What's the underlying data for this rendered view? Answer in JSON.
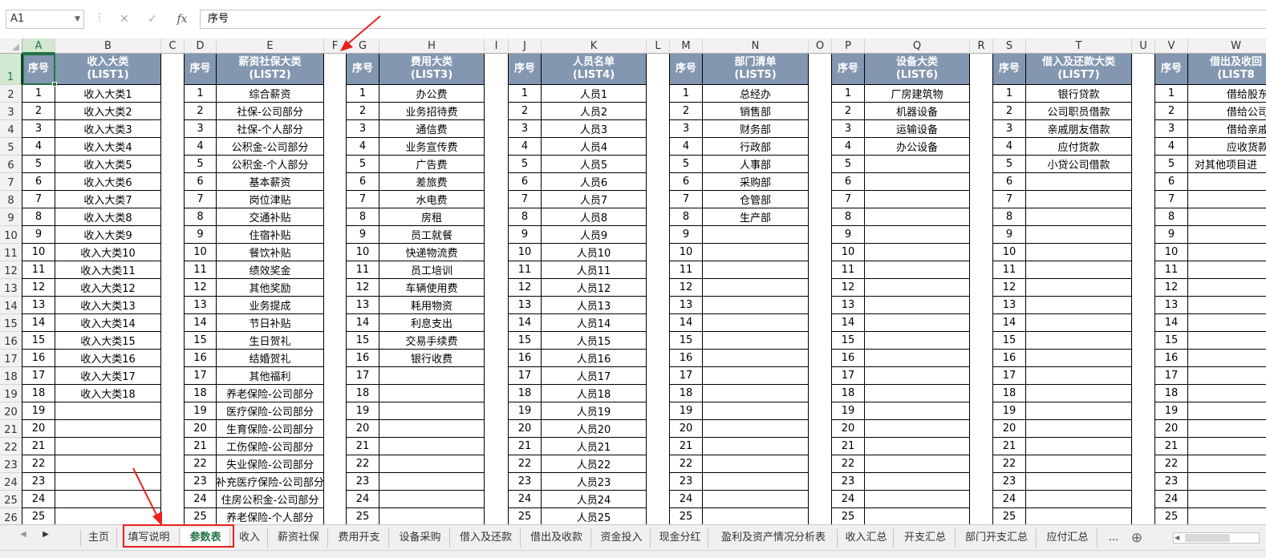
{
  "namebox": {
    "value": "A1"
  },
  "formula": {
    "value": "序号",
    "cancel_icon": "✕",
    "enter_icon": "✓",
    "fx_label": "fx"
  },
  "columns": [
    "A",
    "B",
    "C",
    "D",
    "E",
    "F",
    "G",
    "H",
    "I",
    "J",
    "K",
    "L",
    "M",
    "N",
    "O",
    "P",
    "Q",
    "R",
    "S",
    "T",
    "U",
    "V",
    "W"
  ],
  "rows": [
    "1",
    "2",
    "3",
    "4",
    "5",
    "6",
    "7",
    "8",
    "9",
    "10",
    "11",
    "12",
    "13",
    "14",
    "15",
    "16",
    "17",
    "18",
    "19",
    "20",
    "21",
    "22",
    "23",
    "24",
    "25",
    "26"
  ],
  "tables": [
    {
      "title": "收入大类",
      "sub": "(LIST1)",
      "items": [
        "收入大类1",
        "收入大类2",
        "收入大类3",
        "收入大类4",
        "收入大类5",
        "收入大类6",
        "收入大类7",
        "收入大类8",
        "收入大类9",
        "收入大类10",
        "收入大类11",
        "收入大类12",
        "收入大类13",
        "收入大类14",
        "收入大类15",
        "收入大类16",
        "收入大类17",
        "收入大类18",
        "",
        "",
        "",
        "",
        "",
        "",
        ""
      ]
    },
    {
      "title": "薪资社保大类",
      "sub": "(LIST2)",
      "items": [
        "综合薪资",
        "社保-公司部分",
        "社保-个人部分",
        "公积金-公司部分",
        "公积金-个人部分",
        "基本薪资",
        "岗位津贴",
        "交通补贴",
        "住宿补贴",
        "餐饮补贴",
        "绩效奖金",
        "其他奖励",
        "业务提成",
        "节日补贴",
        "生日贺礼",
        "结婚贺礼",
        "其他福利",
        "养老保险-公司部分",
        "医疗保险-公司部分",
        "生育保险-公司部分",
        "工伤保险-公司部分",
        "失业保险-公司部分",
        "补充医疗保险-公司部分",
        "住房公积金-公司部分",
        "养老保险-个人部分"
      ]
    },
    {
      "title": "费用大类",
      "sub": "(LIST3)",
      "items": [
        "办公费",
        "业务招待费",
        "通信费",
        "业务宣传费",
        "广告费",
        "差旅费",
        "水电费",
        "房租",
        "员工就餐",
        "快递物流费",
        "员工培训",
        "车辆使用费",
        "耗用物资",
        "利息支出",
        "交易手续费",
        "银行收费",
        "",
        "",
        "",
        "",
        "",
        "",
        "",
        "",
        ""
      ]
    },
    {
      "title": "人员名单",
      "sub": "(LIST4)",
      "items": [
        "人员1",
        "人员2",
        "人员3",
        "人员4",
        "人员5",
        "人员6",
        "人员7",
        "人员8",
        "人员9",
        "人员10",
        "人员11",
        "人员12",
        "人员13",
        "人员14",
        "人员15",
        "人员16",
        "人员17",
        "人员18",
        "人员19",
        "人员20",
        "人员21",
        "人员22",
        "人员23",
        "人员24",
        "人员25"
      ]
    },
    {
      "title": "部门清单",
      "sub": "(LIST5)",
      "items": [
        "总经办",
        "销售部",
        "财务部",
        "行政部",
        "人事部",
        "采购部",
        "仓管部",
        "生产部",
        "",
        "",
        "",
        "",
        "",
        "",
        "",
        "",
        "",
        "",
        "",
        "",
        "",
        "",
        "",
        "",
        ""
      ]
    },
    {
      "title": "设备大类",
      "sub": "(LIST6)",
      "items": [
        "厂房建筑物",
        "机器设备",
        "运输设备",
        "办公设备",
        "",
        "",
        "",
        "",
        "",
        "",
        "",
        "",
        "",
        "",
        "",
        "",
        "",
        "",
        "",
        "",
        "",
        "",
        "",
        "",
        ""
      ]
    },
    {
      "title": "借入及还款大类",
      "sub": "(LIST7)",
      "items": [
        "银行贷款",
        "公司职员借款",
        "亲戚朋友借款",
        "应付货款",
        "小贷公司借款",
        "",
        "",
        "",
        "",
        "",
        "",
        "",
        "",
        "",
        "",
        "",
        "",
        "",
        "",
        "",
        "",
        "",
        "",
        "",
        ""
      ]
    },
    {
      "title": "借出及收回",
      "sub": "(LIST8",
      "items": [
        "借给股东",
        "借给公司职",
        "借给亲戚朋",
        "应收货款",
        "对其他项目进",
        "",
        "",
        "",
        "",
        "",
        "",
        "",
        "",
        "",
        "",
        "",
        "",
        "",
        "",
        "",
        "",
        "",
        "",
        "",
        ""
      ]
    }
  ],
  "seq_header": "序号",
  "sheet_tabs": [
    "主页",
    "填写说明",
    "参数表",
    "收入",
    "薪资社保",
    "费用开支",
    "设备采购",
    "借入及还款",
    "借出及收款",
    "资金投入",
    "现金分红",
    "盈利及资产情况分析表",
    "收入汇总",
    "开支汇总",
    "部门开支汇总",
    "应付汇总"
  ],
  "active_tab": "参数表",
  "tabs_more": "...",
  "add_sheet_icon": "⊕",
  "colors": {
    "header_fill": "#8497b0",
    "accent": "#217346",
    "annotation": "#e8211f"
  }
}
